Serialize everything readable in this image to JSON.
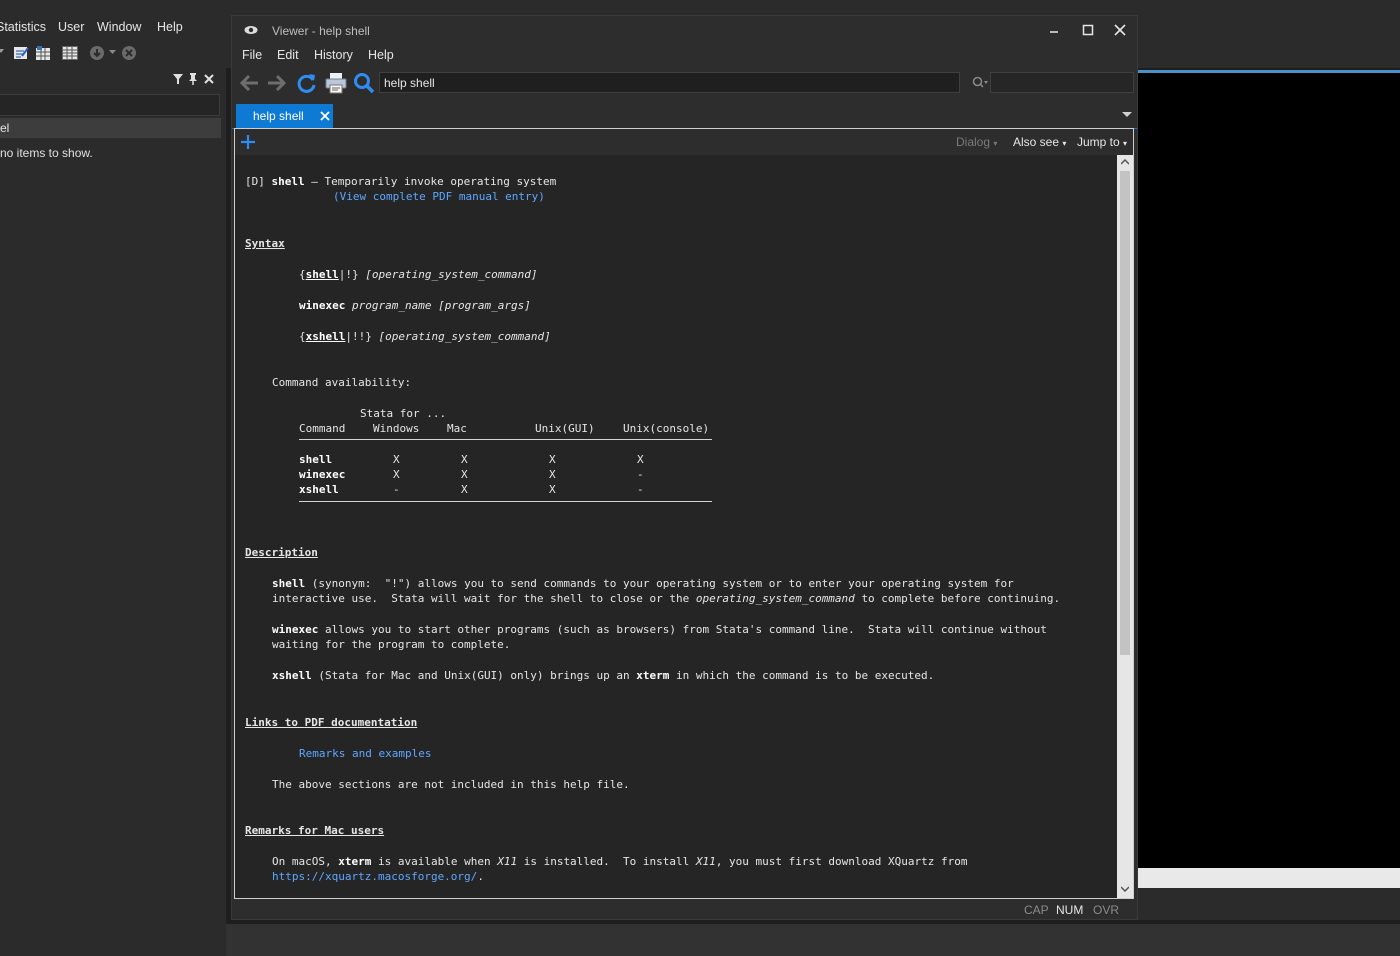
{
  "main_window": {
    "menu": [
      "Statistics",
      "User",
      "Window",
      "Help"
    ],
    "left_panel": {
      "row_label": "el",
      "empty_message": "no items to show."
    }
  },
  "viewer": {
    "title": "Viewer - help shell",
    "menu": [
      "File",
      "Edit",
      "History",
      "Help"
    ],
    "search_value": "help shell",
    "tab_label": "help shell",
    "toolbar_dropdowns": [
      "Dialog",
      "Also see",
      "Jump to"
    ],
    "status": [
      "CAP",
      "NUM",
      "OVR"
    ]
  },
  "help": {
    "header_tag": "[D]",
    "header_cmd": "shell",
    "header_dash": "—",
    "header_desc": "Temporarily invoke operating system",
    "pdf_link": "(View complete PDF manual entry)",
    "syntax_heading": "Syntax",
    "syn1": {
      "open": "{",
      "cmd": "shell",
      "sep": "|!}",
      "arg": "[operating_system_command]"
    },
    "syn2": {
      "cmd": "winexec",
      "arg1": "program_name",
      "arg2": "[program_args]"
    },
    "syn3": {
      "open": "{",
      "cmd": "xshell",
      "sep": "|!!}",
      "arg": "[operating_system_command]"
    },
    "availability_label": "Command availability:",
    "table_super": "Stata for ...",
    "table_headers": [
      "Command",
      "Windows",
      "Mac",
      "Unix(GUI)",
      "Unix(console)"
    ],
    "table_rows": [
      [
        "shell",
        "X",
        "X",
        "X",
        "X"
      ],
      [
        "winexec",
        "X",
        "X",
        "X",
        "-"
      ],
      [
        "xshell",
        "-",
        "X",
        "X",
        "-"
      ]
    ],
    "description_heading": "Description",
    "d1": {
      "cmd": "shell",
      "a": "(synonym:  \"!\") allows you to send commands to your operating system or to enter your operating system for",
      "b": "interactive use.  Stata will wait for the shell to close or the",
      "c": "operating_system_command",
      "d": "to complete before continuing."
    },
    "d2": {
      "cmd": "winexec",
      "a": "allows you to start other programs (such as browsers) from Stata's command line.  Stata will continue without",
      "b": "waiting for the program to complete."
    },
    "d3": {
      "cmd": "xshell",
      "a": "(Stata for Mac and Unix(GUI) only) brings up an",
      "cmd2": "xterm",
      "b": "in which the command is to be executed."
    },
    "links_heading": "Links to PDF documentation",
    "remarks_link": "Remarks and examples",
    "not_included": "The above sections are not included in this help file.",
    "mac_heading": "Remarks for Mac users",
    "mac": {
      "a": "On macOS,",
      "cmd": "xterm",
      "b": "is available when",
      "x11": "X11",
      "c": "is installed.  To install",
      "x11b": "X11",
      "d": ", you must first download XQuartz from",
      "url": "https://xquartz.macosforge.org/",
      "end": "."
    }
  },
  "colors": {
    "accent": "#0e7ad3",
    "link": "#5ea7ff",
    "background": "#252526"
  }
}
